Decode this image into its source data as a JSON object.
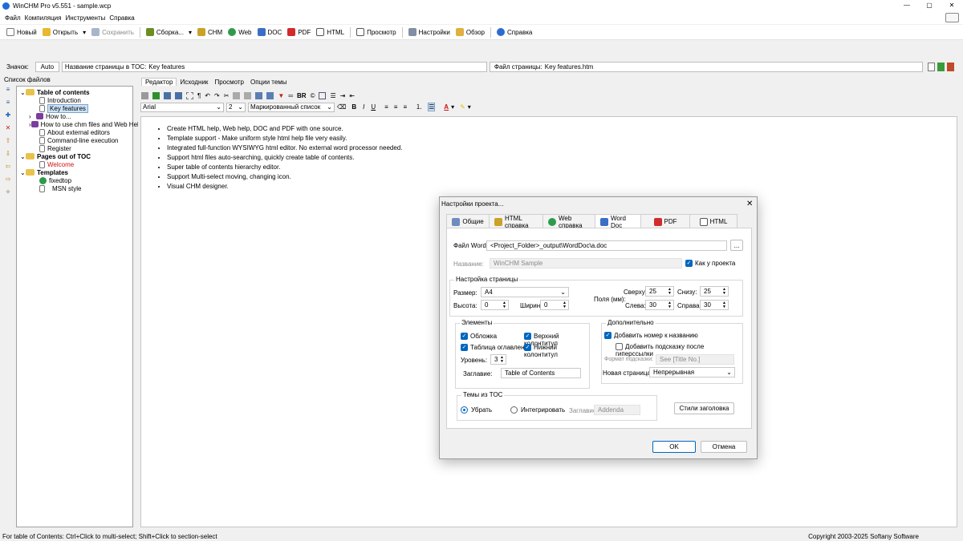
{
  "app": {
    "title": "WinCHM Pro v5.551 - sample.wcp",
    "window_controls": [
      "—",
      "▢",
      "✕"
    ]
  },
  "menu": [
    "Файл",
    "Компиляция",
    "Инструменты",
    "Справка"
  ],
  "toolbar": {
    "new": "Новый",
    "open": "Открыть",
    "save": "Сохранить",
    "build": "Сборка...",
    "chm": "CHM",
    "web": "Web",
    "doc": "DOC",
    "pdf": "PDF",
    "html": "HTML",
    "preview": "Просмотр",
    "settings": "Настройки",
    "browse": "Обзор",
    "help": "Справка"
  },
  "infobar": {
    "icon_label": "Значок:",
    "icon_value": "Auto",
    "toc_label": "Название страницы в TOC:",
    "toc_value": "Key features",
    "file_label": "Файл страницы:",
    "file_value": "Key features.htm"
  },
  "left_panel": {
    "title": "Список файлов",
    "tree": [
      {
        "label": "Table of contents",
        "bold": true,
        "level": 0
      },
      {
        "label": "Introduction",
        "bold": false,
        "level": 1
      },
      {
        "label": "Key features",
        "bold": false,
        "level": 1,
        "selected": true
      },
      {
        "label": "How to...",
        "bold": false,
        "level": 1
      },
      {
        "label": "How to use chm files and Web Help",
        "bold": false,
        "level": 1
      },
      {
        "label": "About external editors",
        "bold": false,
        "level": 1
      },
      {
        "label": "Command-line execution",
        "bold": false,
        "level": 1
      },
      {
        "label": "Register",
        "bold": false,
        "level": 1
      },
      {
        "label": "Pages out of TOC",
        "bold": true,
        "level": 0
      },
      {
        "label": "Welcome",
        "bold": false,
        "level": 1,
        "red": true
      },
      {
        "label": "Templates",
        "bold": true,
        "level": 0
      },
      {
        "label": "fixedtop",
        "bold": false,
        "level": 1
      },
      {
        "label": "MSN style",
        "bold": false,
        "level": 1
      }
    ]
  },
  "editor": {
    "tabs": [
      "Редактор",
      "Исходник",
      "Просмотр",
      "Опции темы"
    ],
    "font": "Arial",
    "size": "2",
    "style": "Маркированный список",
    "bullets": [
      "Create HTML help, Web help, DOC and PDF with one source.",
      "Template support - Make uniform style html help file very easily.",
      "Integrated full-function WYSIWYG html editor. No external word processor needed.",
      "Support html files auto-searching, quickly create table of contents.",
      "Super table of contents hierarchy editor.",
      "Support Multi-select moving, changing icon.",
      "Visual CHM designer."
    ]
  },
  "status": {
    "left": "For table of Contents: Ctrl+Click to multi-select; Shift+Click to section-select",
    "right": "Copyright 2003-2025 Softany Software"
  },
  "dialog": {
    "title": "Настройки проекта...",
    "tabs": [
      "Общие",
      "HTML справка",
      "Web справка",
      "Word Doc",
      "PDF",
      "HTML"
    ],
    "active_tab": "Word Doc",
    "word_file_label": "Файл Word:",
    "word_file_value": "<Project_Folder>_output\\WordDoc\\a.doc",
    "browse_btn": "...",
    "name_label": "Название:",
    "name_value": "WinCHM Sample",
    "as_project": "Как у проекта",
    "page_setup": {
      "title": "Настройка страницы",
      "size_label": "Размер:",
      "size_value": "A4",
      "height_label": "Высота:",
      "height_value": "0",
      "width_label": "Ширина:",
      "width_value": "0",
      "margins_label": "Поля (мм):",
      "top_label": "Сверху:",
      "top_value": "25",
      "bottom_label": "Снизу:",
      "bottom_value": "25",
      "left_label": "Слева:",
      "left_value": "30",
      "right_label": "Справа:",
      "right_value": "30"
    },
    "elements": {
      "title": "Элементы",
      "cover": "Обложка",
      "header": "Верхний колонтитул",
      "toc": "Таблица оглавления",
      "footer": "Нижний колонтитул",
      "level_label": "Уровень:",
      "level_value": "3",
      "heading_label": "Заглавие:",
      "heading_value": "Table of Contents"
    },
    "extra": {
      "title": "Дополнительно",
      "add_number": "Добавить номер к названию",
      "add_tooltip": "Добавить подсказку после гиперссылки",
      "tooltip_format_label": "Формат подсказки:",
      "tooltip_format_value": "See [Title No.]",
      "new_page_label": "Новая страница:",
      "new_page_value": "Непрерывная"
    },
    "toc_topics": {
      "title": "Темы из TOC",
      "remove": "Убрать",
      "integrate": "Интегрировать",
      "heading_label": "Заглавие:",
      "heading_value": "Addenda"
    },
    "heading_styles_btn": "Стили заголовка",
    "ok": "OK",
    "cancel": "Отмена"
  }
}
